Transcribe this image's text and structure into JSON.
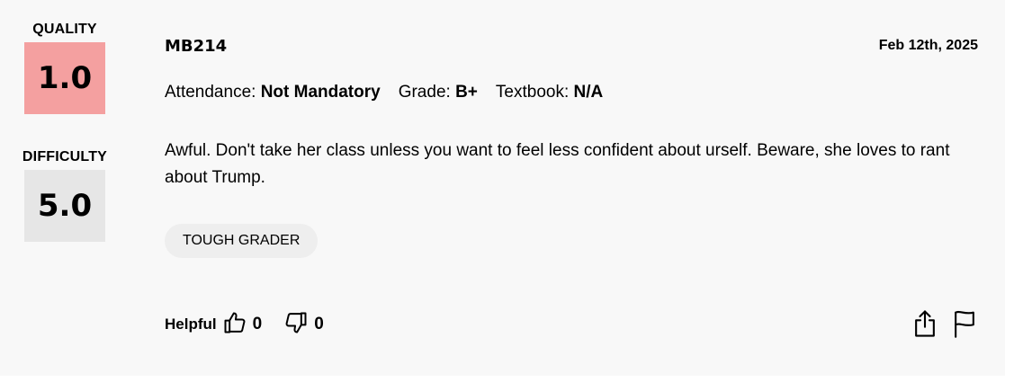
{
  "rating": {
    "quality_label": "QUALITY",
    "quality_value": "1.0",
    "difficulty_label": "DIFFICULTY",
    "difficulty_value": "5.0"
  },
  "review": {
    "course": "MB214",
    "date": "Feb 12th, 2025",
    "attendance_label": "Attendance:",
    "attendance_value": "Not Mandatory",
    "grade_label": "Grade:",
    "grade_value": "B+",
    "textbook_label": "Textbook:",
    "textbook_value": "N/A",
    "comment": "Awful. Don't take her class unless you want to feel less confident about urself. Beware, she loves to rant about Trump.",
    "tags": [
      "TOUGH GRADER"
    ]
  },
  "feedback": {
    "helpful_label": "Helpful",
    "thumbs_up_count": "0",
    "thumbs_down_count": "0"
  },
  "icons": {
    "thumbs_up": "thumbs-up-icon",
    "thumbs_down": "thumbs-down-icon",
    "share": "share-icon",
    "flag": "flag-icon"
  },
  "colors": {
    "quality_box": "#f4a0a0",
    "difficulty_box": "#e6e6e6",
    "card_background": "#f8f8f8",
    "tag_background": "#eeeeee"
  }
}
